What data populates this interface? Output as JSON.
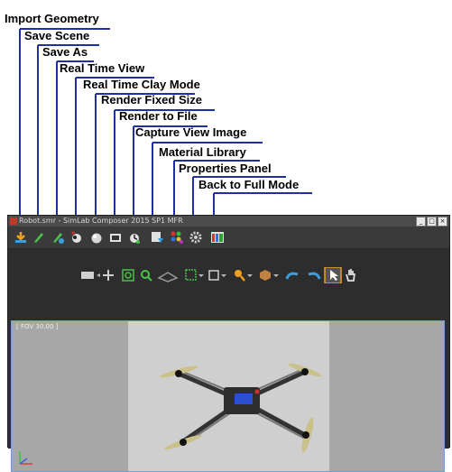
{
  "callouts": {
    "import_geometry": "Import Geometry",
    "save_scene": "Save Scene",
    "save_as": "Save As",
    "real_time_view": "Real Time View",
    "real_time_clay_mode": "Real Time Clay Mode",
    "render_fixed_size": "Render Fixed Size",
    "render_to_file": "Render to File",
    "capture_view_image": "Capture View Image",
    "material_library": "Material Library",
    "properties_panel": "Properties Panel",
    "back_to_full_mode": "Back to Full Mode"
  },
  "window": {
    "title": "Robot.smr - SimLab Composer 2015 SP1 MFR",
    "minimize": "_",
    "maximize": "□",
    "close": "×"
  },
  "viewport": {
    "fov_label": "[ FOV 30.00 ]"
  },
  "colors": {
    "accent": "#1f2fa8",
    "window_bg": "#3c3c3c",
    "viewport_border": "#6fa0d8"
  },
  "icons": {
    "toolbar": [
      "import-geometry-icon",
      "save-scene-icon",
      "save-as-icon",
      "real-time-view-icon",
      "real-time-clay-mode-icon",
      "render-fixed-size-icon",
      "render-to-file-icon",
      "capture-view-image-icon",
      "material-library-icon",
      "properties-panel-icon",
      "back-to-full-mode-icon"
    ]
  }
}
